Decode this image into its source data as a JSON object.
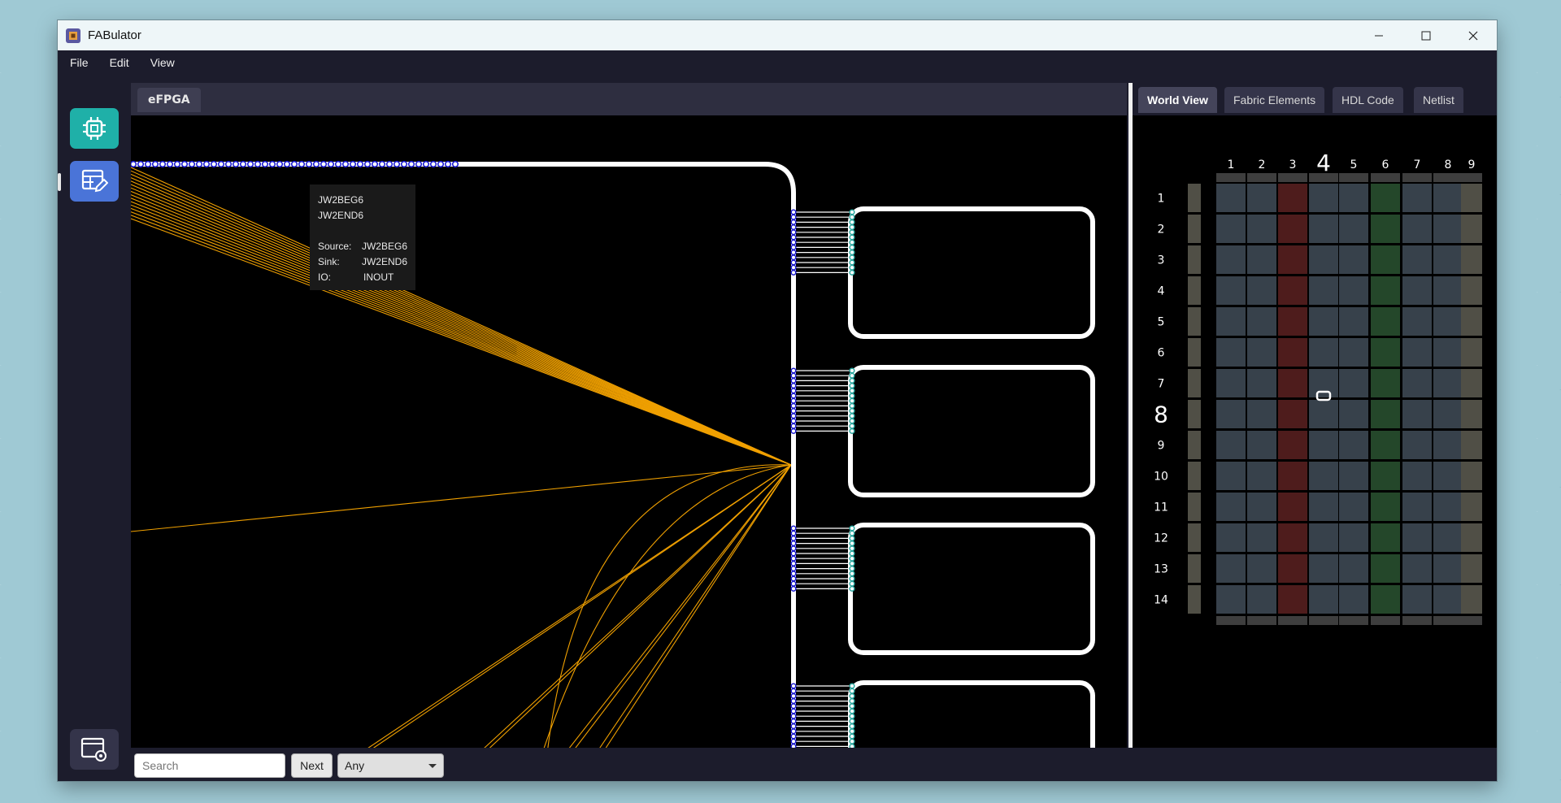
{
  "window": {
    "title": "FABulator"
  },
  "menu": {
    "items": [
      "File",
      "Edit",
      "View"
    ]
  },
  "sidebar": {
    "buttons": [
      {
        "icon": "chip-icon",
        "color": "#1fb0a8"
      },
      {
        "icon": "table-edit-icon",
        "color": "#4a74d8"
      },
      {
        "icon": "window-settings-icon",
        "color": "#34344a"
      }
    ]
  },
  "editor": {
    "tab_label": "eFPGA",
    "tooltip": {
      "line1": "JW2BEG6",
      "line2": "JW2END6",
      "source_label": "Source:",
      "source_value": "JW2BEG6",
      "sink_label": "Sink:",
      "sink_value": "JW2END6",
      "io_label": "IO:",
      "io_value": "INOUT"
    },
    "wire_color": "#f0a000",
    "port_color_blue": "#1a1ad0",
    "port_color_teal": "#2aa8a0"
  },
  "right_panel": {
    "tabs": [
      "World View",
      "Fabric Elements",
      "HDL Code",
      "Netlist"
    ],
    "active_tab": "World View",
    "world": {
      "columns": [
        "1",
        "2",
        "3",
        "4",
        "5",
        "6",
        "7",
        "8",
        "9"
      ],
      "rows": [
        "1",
        "2",
        "3",
        "4",
        "5",
        "6",
        "7",
        "8",
        "9",
        "10",
        "11",
        "12",
        "13",
        "14"
      ],
      "highlight_col": "4",
      "highlight_row": "8",
      "colors": {
        "default": "#37414b",
        "edge": "#504f46",
        "red": "#4e1c1c",
        "green": "#24472a",
        "io": "#3e3e3e"
      }
    }
  },
  "bottom": {
    "search_placeholder": "Search",
    "next_label": "Next",
    "filter_value": "Any"
  }
}
